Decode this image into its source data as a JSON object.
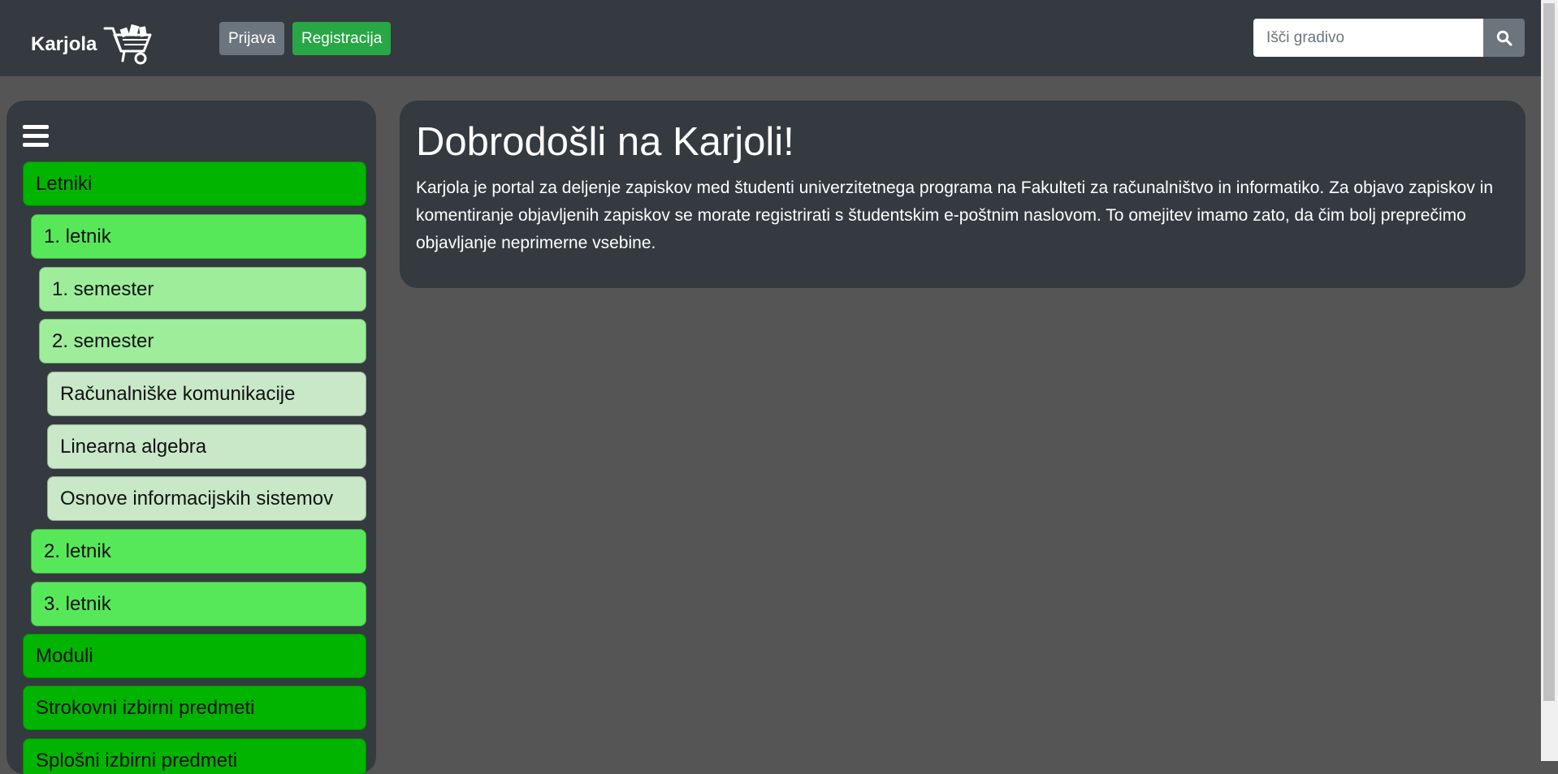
{
  "header": {
    "brand": "Karjola",
    "brand_icon": "wheelbarrow-icon",
    "login_label": "Prijava",
    "register_label": "Registracija",
    "search_placeholder": "Išči gradivo",
    "search_icon": "search-icon"
  },
  "sidebar": {
    "toggle_icon": "hamburger-menu-icon",
    "items": [
      {
        "label": "Letniki",
        "level": 0
      },
      {
        "label": "1. letnik",
        "level": 1
      },
      {
        "label": "1. semester",
        "level": 2
      },
      {
        "label": "2. semester",
        "level": 2
      },
      {
        "label": "Računalniške komunikacije",
        "level": 3
      },
      {
        "label": "Linearna algebra",
        "level": 3
      },
      {
        "label": "Osnove informacijskih sistemov",
        "level": 3
      },
      {
        "label": "2. letnik",
        "level": 1
      },
      {
        "label": "3. letnik",
        "level": 1
      },
      {
        "label": "Moduli",
        "level": 0
      },
      {
        "label": "Strokovni izbirni predmeti",
        "level": 0
      },
      {
        "label": "Splošni izbirni predmeti",
        "level": 0
      }
    ]
  },
  "main": {
    "title": "Dobrodošli na Karjoli!",
    "text": "Karjola je portal za deljenje zapiskov med študenti univerzitetnega programa na Fakulteti za računalništvo in informatiko. Za objavo zapiskov in komentiranje objavljenih zapiskov se morate registrirati s študentskim e-poštnim naslovom. To omejitev imamo zato, da čim bolj preprečimo objavljanje neprimerne vsebine."
  },
  "colors": {
    "navbar": "#343a40",
    "page_background": "#555555",
    "level0": "#00b400",
    "level1": "#57e85a",
    "level2": "#9ded9b",
    "level3": "#c8e8c8",
    "login_button": "#6c757d",
    "register_button": "#28a745"
  }
}
